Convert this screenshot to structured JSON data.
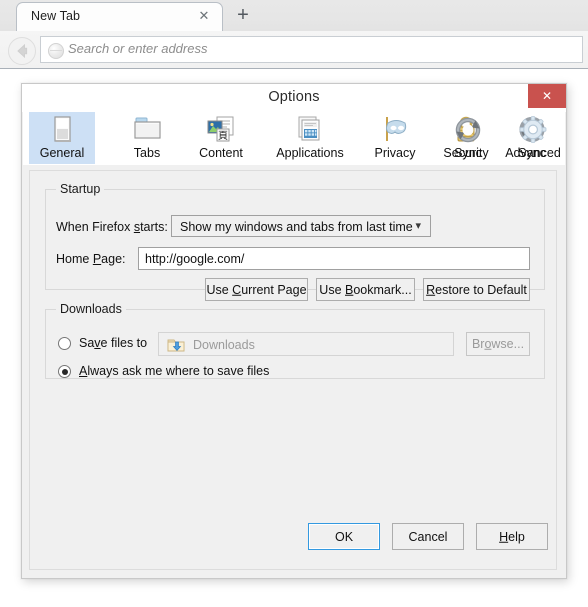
{
  "browser": {
    "tab": {
      "title": "New Tab",
      "close_icon": "close-icon"
    },
    "new_tab_button": "+",
    "back_button_icon": "back-arrow-icon",
    "address_bar": {
      "placeholder": "Search or enter address",
      "value": ""
    }
  },
  "dialog": {
    "title": "Options",
    "close_label": "✕",
    "close_color": "#c9524e",
    "selected_tab_color": "#cde0f5",
    "tabs": [
      {
        "id": "general",
        "label": "General",
        "icon": "general-window-icon",
        "selected": true
      },
      {
        "id": "tabs",
        "label": "Tabs",
        "icon": "tabs-folder-icon",
        "selected": false
      },
      {
        "id": "content",
        "label": "Content",
        "icon": "content-page-icon",
        "selected": false
      },
      {
        "id": "applications",
        "label": "Applications",
        "icon": "applications-icon",
        "selected": false
      },
      {
        "id": "privacy",
        "label": "Privacy",
        "icon": "privacy-mask-icon",
        "selected": false
      },
      {
        "id": "security",
        "label": "Security",
        "icon": "security-lock-icon",
        "selected": false
      },
      {
        "id": "sync",
        "label": "Sync",
        "icon": "sync-arrows-icon",
        "selected": false
      },
      {
        "id": "advanced",
        "label": "Advanced",
        "icon": "advanced-gear-icon",
        "selected": false
      }
    ],
    "startup": {
      "legend": "Startup",
      "when_firefox_starts_label": "When Firefox starts:",
      "when_firefox_starts_value": "Show my windows and tabs from last time",
      "home_page_label": "Home Page:",
      "home_page_value": "http://google.com/",
      "use_current_page": "Use Current Page",
      "use_bookmark": "Use Bookmark...",
      "restore_to_default": "Restore to Default"
    },
    "downloads": {
      "legend": "Downloads",
      "save_files_to_label": "Save files to",
      "save_files_to_selected": false,
      "folder_value": "Downloads",
      "folder_icon": "download-folder-icon",
      "browse_label": "Browse...",
      "browse_disabled": true,
      "always_ask_label": "Always ask me where to save files",
      "always_ask_selected": true
    },
    "footer": {
      "ok": "OK",
      "cancel": "Cancel",
      "help": "Help",
      "focused": "ok"
    }
  }
}
